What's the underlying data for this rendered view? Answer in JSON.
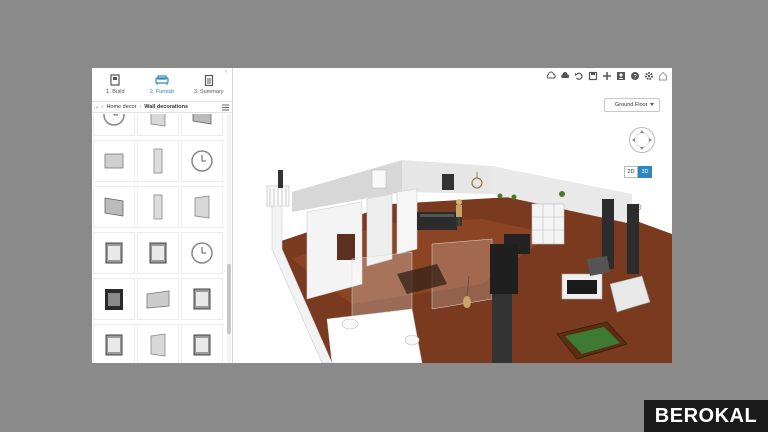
{
  "mode_tabs": [
    {
      "label": "1. Build",
      "icon": "build-icon",
      "active": false
    },
    {
      "label": "2. Furnish",
      "icon": "sofa-icon",
      "active": true
    },
    {
      "label": "3. Summary",
      "icon": "clipboard-icon",
      "active": false
    }
  ],
  "breadcrumb": {
    "ellipsis": "...",
    "parent": "Home decor",
    "current": "Wall decorations"
  },
  "catalog": {
    "items": [
      "wall-clock",
      "mirror",
      "frame",
      "mirror-rect",
      "mirror-tall",
      "wall-clock",
      "frame",
      "mirror-tall",
      "mirror",
      "picture-frame",
      "picture-frame",
      "wall-clock",
      "poster",
      "mirror-wide",
      "picture-frame",
      "picture-frame",
      "mirror",
      "picture-frame"
    ]
  },
  "toolbar": {
    "icons": [
      "cloud-save-icon",
      "cloud-open-icon",
      "undo-icon",
      "save-icon",
      "add-icon",
      "user-icon",
      "help-icon",
      "settings-icon",
      "home-icon"
    ]
  },
  "floor_select": {
    "value": "Ground Floor"
  },
  "view_toggle": {
    "option_2d": "2D",
    "option_3d": "3D",
    "active": "3D"
  },
  "colors": {
    "accent": "#2e86c1",
    "floor_wood": "#7a3a20",
    "wall": "#e8e8e8"
  },
  "watermark": {
    "text": "BEROKAL"
  }
}
